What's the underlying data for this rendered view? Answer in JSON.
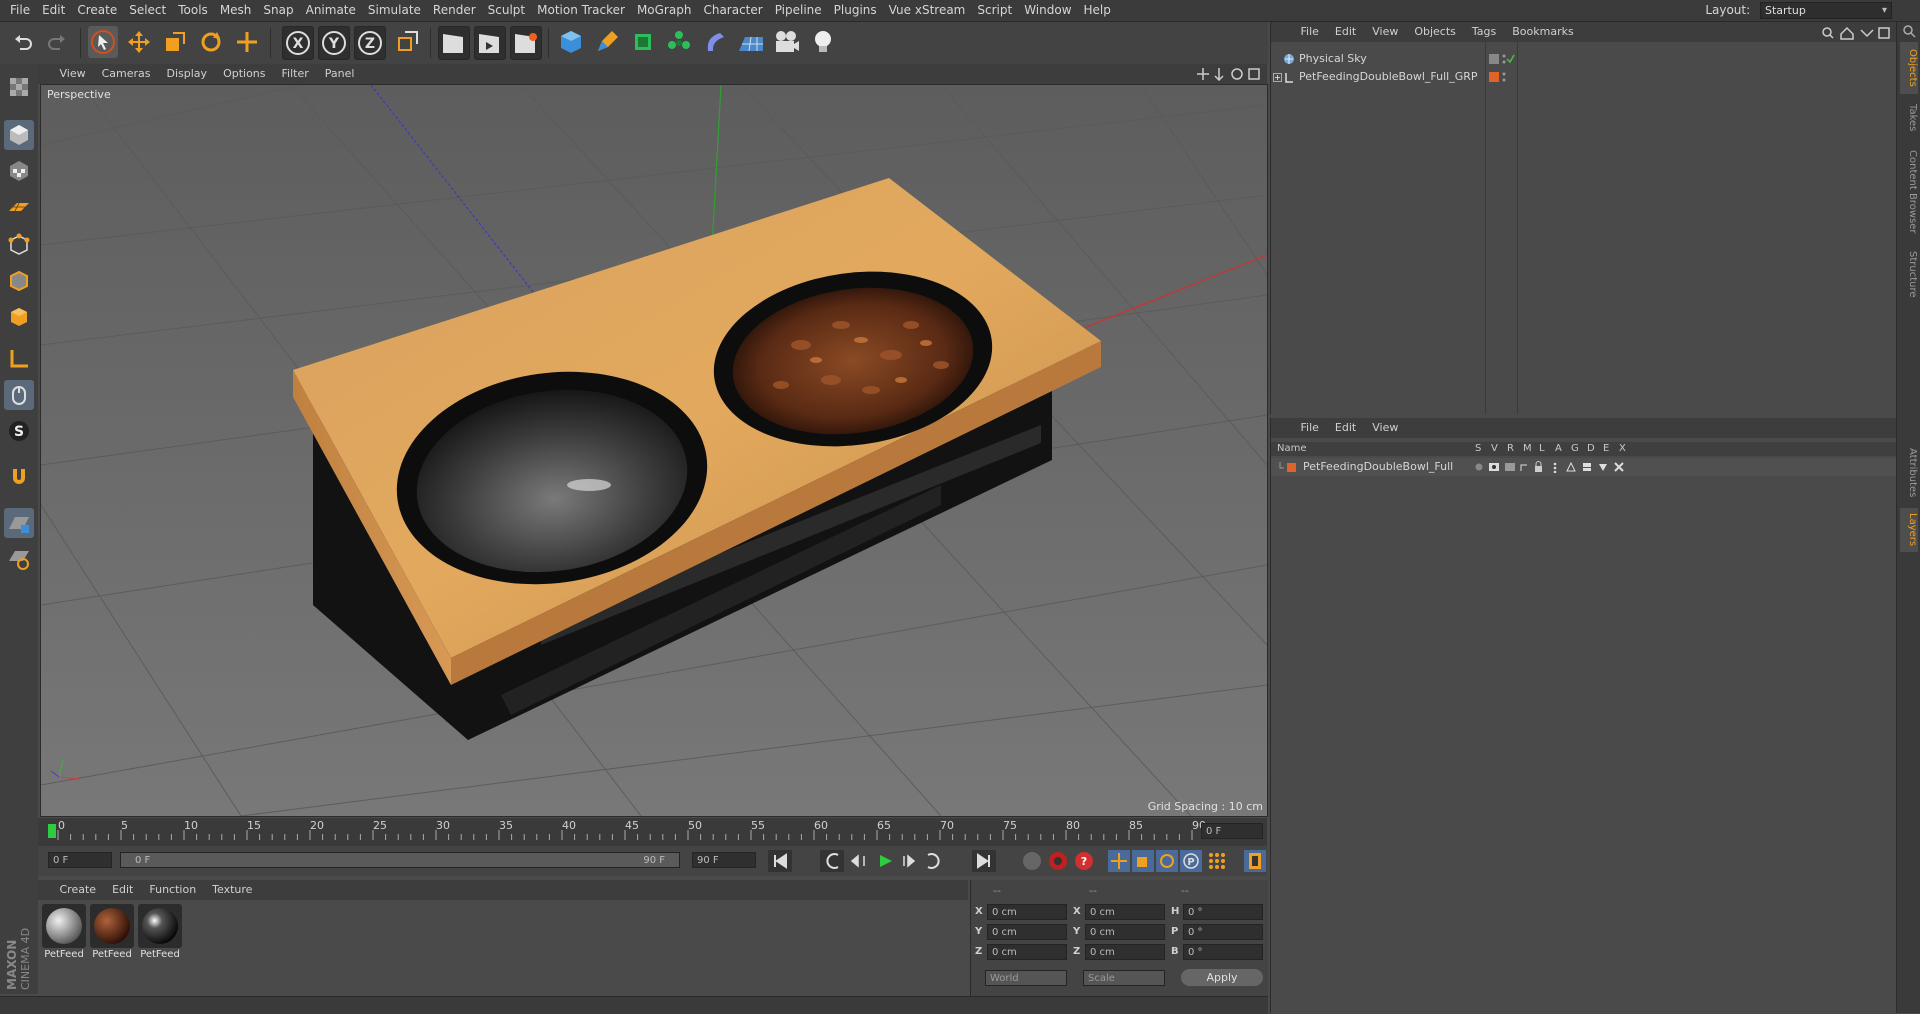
{
  "menubar": {
    "items": [
      "File",
      "Edit",
      "Create",
      "Select",
      "Tools",
      "Mesh",
      "Snap",
      "Animate",
      "Simulate",
      "Render",
      "Sculpt",
      "Motion Tracker",
      "MoGraph",
      "Character",
      "Pipeline",
      "Plugins",
      "Vue xStream",
      "Script",
      "Window",
      "Help"
    ],
    "layout_label": "Layout:",
    "layout_value": "Startup"
  },
  "toolbar": {
    "axis_x": "X",
    "axis_y": "Y",
    "axis_z": "Z"
  },
  "viewport": {
    "menu": [
      "View",
      "Cameras",
      "Display",
      "Options",
      "Filter",
      "Panel"
    ],
    "camera_label": "Perspective",
    "grid_spacing": "Grid Spacing : 10 cm"
  },
  "timeline": {
    "ticks": [
      "0",
      "5",
      "10",
      "15",
      "20",
      "25",
      "30",
      "35",
      "40",
      "45",
      "50",
      "55",
      "60",
      "65",
      "70",
      "75",
      "80",
      "85",
      "90"
    ],
    "end_field": "0 F",
    "current_frame": "0 F",
    "range_start": "0 F",
    "range_end": "90 F",
    "max_frame": "90 F"
  },
  "material_manager": {
    "menu": [
      "Create",
      "Edit",
      "Function",
      "Texture"
    ],
    "materials": [
      {
        "label": "PetFeed",
        "icon": "metal-material-icon",
        "color": "#9a9a9a"
      },
      {
        "label": "PetFeed",
        "icon": "food-material-icon",
        "color": "#6a2e1c"
      },
      {
        "label": "PetFeed",
        "icon": "black-material-icon",
        "color": "#1a1a1a"
      }
    ]
  },
  "coordinates": {
    "header_a": "--",
    "header_b": "--",
    "header_c": "--",
    "rows": [
      {
        "l1": "X",
        "v1": "0 cm",
        "l2": "X",
        "v2": "0 cm",
        "l3": "H",
        "v3": "0 °"
      },
      {
        "l1": "Y",
        "v1": "0 cm",
        "l2": "Y",
        "v2": "0 cm",
        "l3": "P",
        "v3": "0 °"
      },
      {
        "l1": "Z",
        "v1": "0 cm",
        "l2": "Z",
        "v2": "0 cm",
        "l3": "B",
        "v3": "0 °"
      }
    ],
    "space": "World",
    "mode": "Scale",
    "apply": "Apply"
  },
  "object_manager": {
    "menu": [
      "File",
      "Edit",
      "View",
      "Objects",
      "Tags",
      "Bookmarks"
    ],
    "objects": [
      {
        "name": "Physical Sky"
      },
      {
        "name": "PetFeedingDoubleBowl_Full_GRP"
      }
    ]
  },
  "layer_manager": {
    "menu": [
      "File",
      "Edit",
      "View"
    ],
    "columns": [
      "Name",
      "S",
      "V",
      "R",
      "M",
      "L",
      "A",
      "G",
      "D",
      "E",
      "X"
    ],
    "layers": [
      {
        "name": "PetFeedingDoubleBowl_Full"
      }
    ]
  },
  "side_tabs": [
    "Objects",
    "Takes",
    "Content Browser",
    "Structure",
    "Attributes",
    "Layers"
  ],
  "branding": "MAXON CINEMA 4D",
  "colors": {
    "accent": "#f0a020",
    "layer_orange": "#e0642a",
    "timeline_green": "#2ecc40"
  }
}
